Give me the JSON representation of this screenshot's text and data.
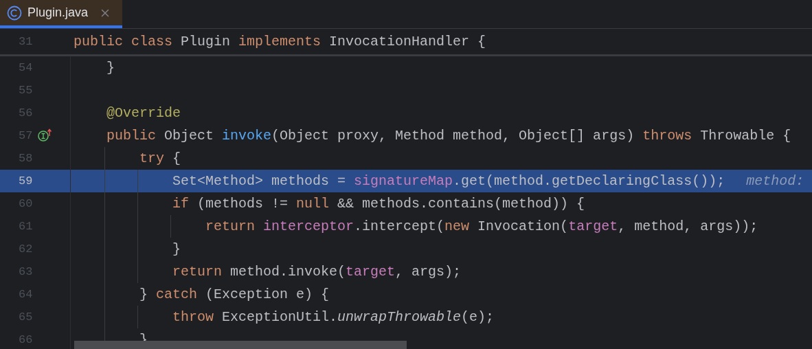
{
  "tab": {
    "label": "Plugin.java",
    "selected": true
  },
  "sticky_line": {
    "number": "31",
    "tokens": [
      {
        "kind": "keyword",
        "text": "public class "
      },
      {
        "kind": "plain",
        "text": "Plugin "
      },
      {
        "kind": "keyword",
        "text": "implements "
      },
      {
        "kind": "plain",
        "text": "InvocationHandler {"
      }
    ]
  },
  "lines": [
    {
      "number": "54",
      "selected": false,
      "tokens": [
        {
          "kind": "plain",
          "text": "    }"
        }
      ]
    },
    {
      "number": "55",
      "selected": false
    },
    {
      "number": "56",
      "selected": false,
      "tokens": [
        {
          "kind": "annotation",
          "text": "    @Override"
        }
      ]
    },
    {
      "number": "57",
      "selected": false,
      "implements_marker": true,
      "tokens": [
        {
          "kind": "keyword",
          "text": "    public "
        },
        {
          "kind": "plain",
          "text": "Object "
        },
        {
          "kind": "method",
          "text": "invoke"
        },
        {
          "kind": "plain",
          "text": "(Object proxy, Method method, Object[] args) "
        },
        {
          "kind": "keyword",
          "text": "throws "
        },
        {
          "kind": "plain",
          "text": "Throwable {"
        }
      ]
    },
    {
      "number": "58",
      "selected": false,
      "tokens": [
        {
          "kind": "keyword",
          "text": "        try "
        },
        {
          "kind": "plain",
          "text": "{"
        }
      ]
    },
    {
      "number": "59",
      "selected": true,
      "tokens": [
        {
          "kind": "plain",
          "text": "            Set<Method> methods = "
        },
        {
          "kind": "field",
          "text": "signatureMap"
        },
        {
          "kind": "plain",
          "text": ".get(method.getDeclaringClass());"
        }
      ],
      "hint": "method:"
    },
    {
      "number": "60",
      "selected": false,
      "tokens": [
        {
          "kind": "keyword",
          "text": "            if"
        },
        {
          "kind": "plain",
          "text": " (methods != "
        },
        {
          "kind": "keyword",
          "text": "null"
        },
        {
          "kind": "plain",
          "text": " && methods.contains(method)) {"
        }
      ]
    },
    {
      "number": "61",
      "selected": false,
      "tokens": [
        {
          "kind": "keyword",
          "text": "                return "
        },
        {
          "kind": "field",
          "text": "interceptor"
        },
        {
          "kind": "plain",
          "text": ".intercept("
        },
        {
          "kind": "keyword",
          "text": "new "
        },
        {
          "kind": "plain",
          "text": "Invocation("
        },
        {
          "kind": "field",
          "text": "target"
        },
        {
          "kind": "plain",
          "text": ", method, args));"
        }
      ]
    },
    {
      "number": "62",
      "selected": false,
      "tokens": [
        {
          "kind": "plain",
          "text": "            }"
        }
      ]
    },
    {
      "number": "63",
      "selected": false,
      "tokens": [
        {
          "kind": "keyword",
          "text": "            return "
        },
        {
          "kind": "plain",
          "text": "method.invoke("
        },
        {
          "kind": "field",
          "text": "target"
        },
        {
          "kind": "plain",
          "text": ", args);"
        }
      ]
    },
    {
      "number": "64",
      "selected": false,
      "tokens": [
        {
          "kind": "plain",
          "text": "        } "
        },
        {
          "kind": "keyword",
          "text": "catch "
        },
        {
          "kind": "plain",
          "text": "(Exception e) {"
        }
      ]
    },
    {
      "number": "65",
      "selected": false,
      "tokens": [
        {
          "kind": "keyword",
          "text": "            throw "
        },
        {
          "kind": "plain",
          "text": "ExceptionUtil."
        },
        {
          "kind": "static",
          "text": "unwrapThrowable"
        },
        {
          "kind": "plain",
          "text": "(e);"
        }
      ]
    },
    {
      "number": "66",
      "selected": false,
      "tokens": [
        {
          "kind": "plain",
          "text": "        }"
        }
      ]
    }
  ]
}
